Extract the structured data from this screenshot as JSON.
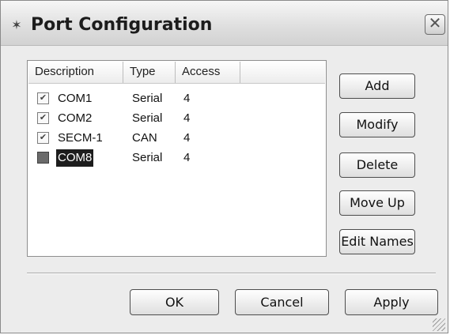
{
  "window": {
    "title": "Port Configuration",
    "icon": "satellite-dish-icon",
    "close_glyph": "✕"
  },
  "list": {
    "columns": [
      "Description",
      "Type",
      "Access"
    ],
    "rows": [
      {
        "checked": true,
        "description": "COM1",
        "type": "Serial",
        "access": "4",
        "selected": false
      },
      {
        "checked": true,
        "description": "COM2",
        "type": "Serial",
        "access": "4",
        "selected": false
      },
      {
        "checked": true,
        "description": "SECM-1",
        "type": "CAN",
        "access": "4",
        "selected": false
      },
      {
        "checked": true,
        "description": "COM8",
        "type": "Serial",
        "access": "4",
        "selected": true
      }
    ]
  },
  "side_buttons": {
    "add": "Add",
    "modify": "Modify",
    "delete": "Delete",
    "move_up": "Move Up",
    "edit_names": "Edit Names"
  },
  "bottom_buttons": {
    "ok": "OK",
    "cancel": "Cancel",
    "apply": "Apply"
  }
}
